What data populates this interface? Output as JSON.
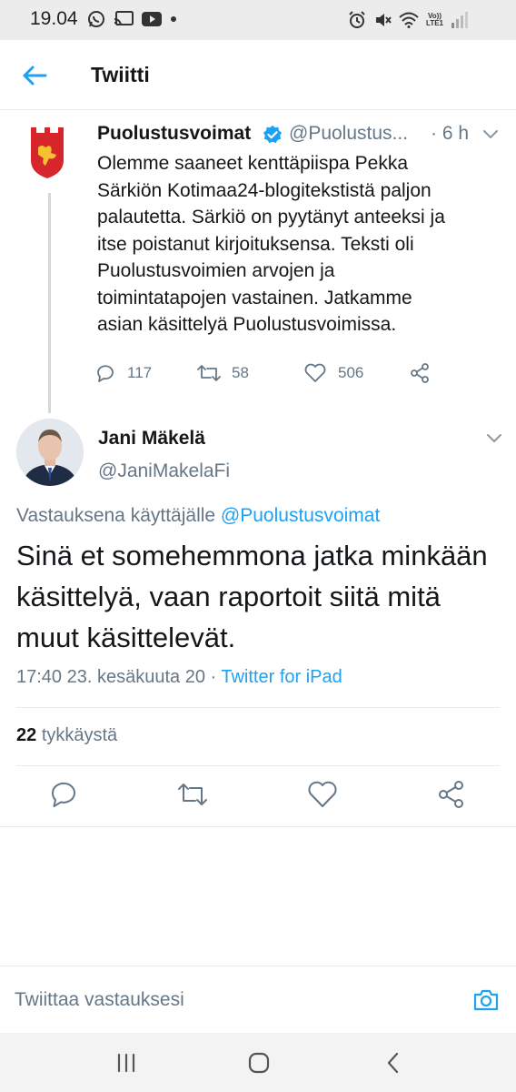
{
  "status_bar": {
    "time": "19.04",
    "left_icons": [
      "whatsapp-icon",
      "cast-icon",
      "youtube-icon",
      "dot-icon"
    ],
    "right_icons": [
      "alarm-icon",
      "mute-icon",
      "wifi-icon",
      "volte-icon",
      "signal-icon"
    ],
    "volte_label_top": "Vo))",
    "volte_label_bottom": "LTE1"
  },
  "header": {
    "title": "Twiitti",
    "back_icon": "back-arrow-icon",
    "accent_color": "#1da1f2"
  },
  "quoted_tweet": {
    "author_name": "Puolustusvoimat",
    "verified": true,
    "handle": "@Puolustus...",
    "time": "· 6 h",
    "text": "Olemme saaneet kenttäpiispa Pekka\nSärkiön Kotimaa24-blogitekstistä paljon\npalautetta. Särkiö on pyytänyt anteeksi ja\nitse poistanut kirjoituksensa. Teksti oli\nPuolustusvoimien arvojen ja\ntoimintatapojen vastainen. Jatkamme\nasian käsittelyä Puolustusvoimissa.",
    "replies": "117",
    "retweets": "58",
    "likes": "506"
  },
  "main_tweet": {
    "author_name": "Jani Mäkelä",
    "handle": "@JaniMakelaFi",
    "reply_prefix": "Vastauksena käyttäjälle",
    "reply_to": "@Puolustusvoimat",
    "text": "Sinä et somehemmona jatka minkään käsittelyä, vaan raportoit siitä mitä muut käsittelevät.",
    "timestamp": "17:40 23. kesäkuuta 20",
    "separator": " · ",
    "source": "Twitter for iPad",
    "likes_count": "22",
    "likes_label": "tykkäystä"
  },
  "composer": {
    "placeholder": "Twiittaa vastauksesi"
  }
}
